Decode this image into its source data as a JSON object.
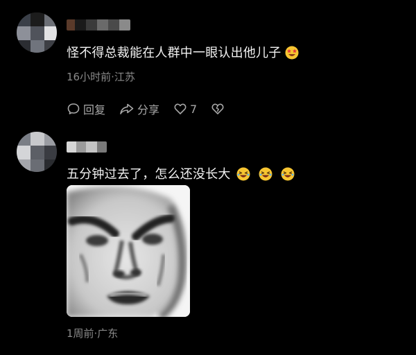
{
  "comments": [
    {
      "text": "怪不得总裁能在人群中一眼认出他儿子",
      "emoji_icons": [
        "star-eyes-emoji-icon"
      ],
      "meta": "16小时前·江苏",
      "actions": {
        "reply_label": "回复",
        "share_label": "分享",
        "like_count": "7"
      }
    },
    {
      "text": "五分钟过去了，怎么还没长大",
      "emoji_icons": [
        "laughing-emoji-icon",
        "laughing-emoji-icon",
        "laughing-emoji-icon"
      ],
      "sticker": "angry-face-meme-sticker",
      "meta": "1周前·广东"
    }
  ],
  "colors": {
    "background": "#000000",
    "text": "#f2f2f2",
    "meta": "#8a8a8a",
    "action": "#a8a8a8",
    "emoji_yellow": "#f7c531"
  }
}
